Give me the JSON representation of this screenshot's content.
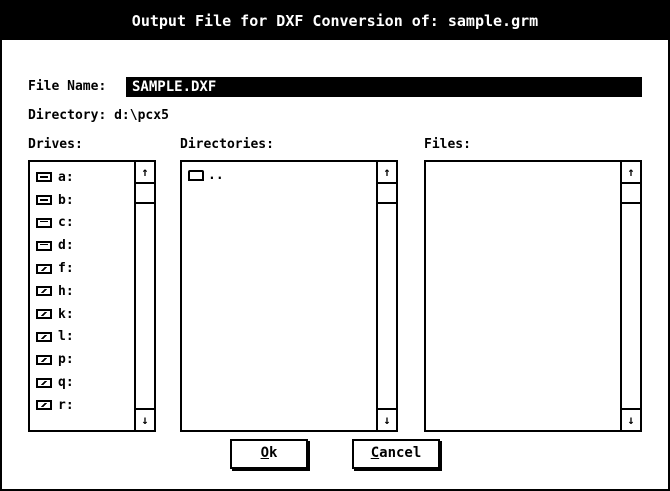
{
  "dialog": {
    "title": "Output File for DXF Conversion of: sample.grm",
    "file_name_label": "File Name:",
    "file_name_value": "SAMPLE.DXF",
    "directory_label": "Directory:",
    "directory_value": "d:\\pcx5",
    "drives_label": "Drives:",
    "directories_label": "Directories:",
    "files_label": "Files:"
  },
  "drives": [
    {
      "label": "a:",
      "icon": "removable-drive-icon"
    },
    {
      "label": "b:",
      "icon": "removable-drive-icon"
    },
    {
      "label": "c:",
      "icon": "fixed-drive-icon"
    },
    {
      "label": "d:",
      "icon": "fixed-drive-icon"
    },
    {
      "label": "f:",
      "icon": "network-drive-icon"
    },
    {
      "label": "h:",
      "icon": "network-drive-icon"
    },
    {
      "label": "k:",
      "icon": "network-drive-icon"
    },
    {
      "label": "l:",
      "icon": "network-drive-icon"
    },
    {
      "label": "p:",
      "icon": "network-drive-icon"
    },
    {
      "label": "q:",
      "icon": "network-drive-icon"
    },
    {
      "label": "r:",
      "icon": "network-drive-icon"
    }
  ],
  "directories": [
    {
      "label": "..",
      "icon": "folder-icon"
    }
  ],
  "files": [],
  "buttons": {
    "ok_mnemonic": "O",
    "ok_rest": "k",
    "cancel_mnemonic": "C",
    "cancel_rest": "ancel"
  },
  "scroll_glyphs": {
    "up": "↑",
    "down": "↓"
  }
}
